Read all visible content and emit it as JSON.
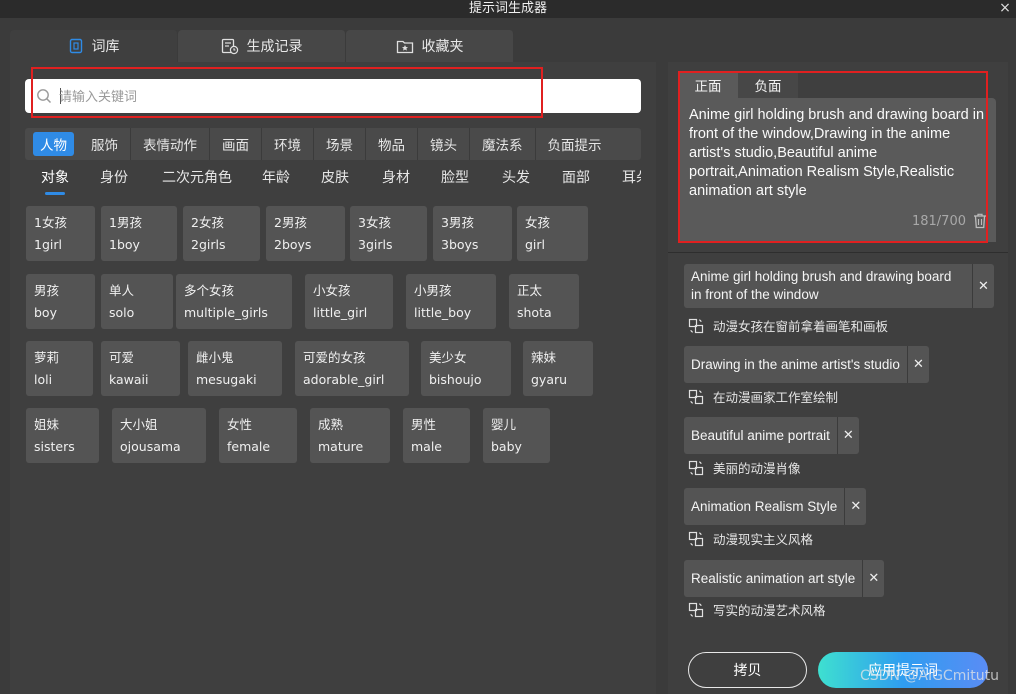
{
  "window": {
    "title": "提示词生成器",
    "close": "×"
  },
  "tabs": [
    {
      "label": "词库",
      "icon": "book-icon"
    },
    {
      "label": "生成记录",
      "icon": "history-icon"
    },
    {
      "label": "收藏夹",
      "icon": "star-folder-icon"
    }
  ],
  "search": {
    "placeholder": "请输入关键词"
  },
  "categories": [
    "人物",
    "服饰",
    "表情动作",
    "画面",
    "环境",
    "场景",
    "物品",
    "镜头",
    "魔法系",
    "负面提示"
  ],
  "active_category": "人物",
  "subcategories": [
    "对象",
    "身份",
    "二次元角色",
    "年龄",
    "皮肤",
    "身材",
    "脸型",
    "头发",
    "面部",
    "耳朵"
  ],
  "active_subcategory": "对象",
  "chips": [
    {
      "zh": "1女孩",
      "en": "1girl"
    },
    {
      "zh": "1男孩",
      "en": "1boy"
    },
    {
      "zh": "2女孩",
      "en": "2girls"
    },
    {
      "zh": "2男孩",
      "en": "2boys"
    },
    {
      "zh": "3女孩",
      "en": "3girls"
    },
    {
      "zh": "3男孩",
      "en": "3boys"
    },
    {
      "zh": "女孩",
      "en": "girl"
    },
    {
      "zh": "男孩",
      "en": "boy"
    },
    {
      "zh": "单人",
      "en": "solo"
    },
    {
      "zh": "多个女孩",
      "en": "multiple_girls"
    },
    {
      "zh": "小女孩",
      "en": "little_girl"
    },
    {
      "zh": "小男孩",
      "en": "little_boy"
    },
    {
      "zh": "正太",
      "en": "shota"
    },
    {
      "zh": "萝莉",
      "en": "loli"
    },
    {
      "zh": "可爱",
      "en": "kawaii"
    },
    {
      "zh": "雌小鬼",
      "en": "mesugaki"
    },
    {
      "zh": "可爱的女孩",
      "en": "adorable_girl"
    },
    {
      "zh": "美少女",
      "en": "bishoujo"
    },
    {
      "zh": "辣妹",
      "en": "gyaru"
    },
    {
      "zh": "姐妹",
      "en": "sisters"
    },
    {
      "zh": "大小姐",
      "en": "ojousama"
    },
    {
      "zh": "女性",
      "en": "female"
    },
    {
      "zh": "成熟",
      "en": "mature"
    },
    {
      "zh": "男性",
      "en": "male"
    },
    {
      "zh": "婴儿",
      "en": "baby"
    }
  ],
  "editor": {
    "tabs": [
      "正面",
      "负面"
    ],
    "active_tab": "正面",
    "text": "Anime girl holding brush and drawing board in front of the window,Drawing in the anime artist's studio,Beautiful anime portrait,Animation Realism Style,Realistic animation art style",
    "count": "181/700"
  },
  "tags": [
    {
      "en": "Anime girl holding brush and drawing board in front of the window",
      "zh": "动漫女孩在窗前拿着画笔和画板"
    },
    {
      "en": "Drawing in the anime artist's studio",
      "zh": "在动漫画家工作室绘制"
    },
    {
      "en": "Beautiful anime portrait",
      "zh": "美丽的动漫肖像"
    },
    {
      "en": "Animation Realism Style",
      "zh": "动漫现实主义风格"
    },
    {
      "en": "Realistic animation art style",
      "zh": "写实的动漫艺术风格"
    }
  ],
  "buttons": {
    "copy": "拷贝",
    "apply": "应用提示词"
  },
  "watermark": "CSDN @AIGCmitutu",
  "colors": {
    "accent": "#2f8be6",
    "highlight_box": "#e02020",
    "apply_gradient_start": "#3ee0d0",
    "apply_gradient_end": "#5a8cf5"
  }
}
